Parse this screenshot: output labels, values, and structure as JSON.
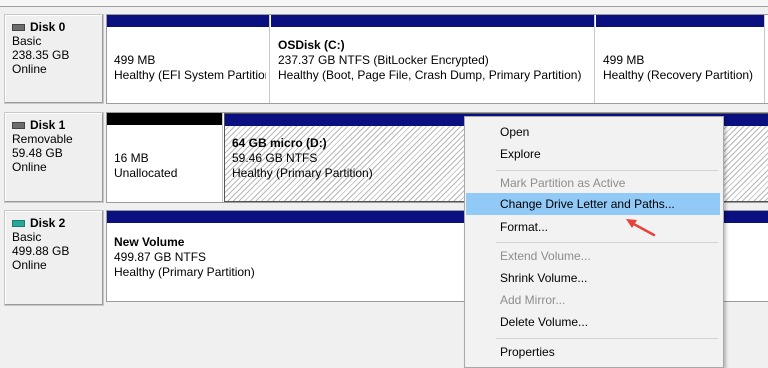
{
  "disks": [
    {
      "name": "Disk 0",
      "type": "Basic",
      "size": "238.35 GB",
      "status": "Online",
      "partitions": [
        {
          "title": "",
          "size": "499 MB",
          "status": "Healthy (EFI System Partition)"
        },
        {
          "title": "OSDisk  (C:)",
          "size": "237.37 GB NTFS (BitLocker Encrypted)",
          "status": "Healthy (Boot, Page File, Crash Dump, Primary Partition)"
        },
        {
          "title": "",
          "size": "499 MB",
          "status": "Healthy (Recovery Partition)"
        }
      ]
    },
    {
      "name": "Disk 1",
      "type": "Removable",
      "size": "59.48 GB",
      "status": "Online",
      "partitions": [
        {
          "title": "",
          "size": "16 MB",
          "status": "Unallocated"
        },
        {
          "title": "64 GB micro  (D:)",
          "size": "59.46 GB NTFS",
          "status": "Healthy (Primary Partition)"
        }
      ]
    },
    {
      "name": "Disk 2",
      "type": "Basic",
      "size": "499.88 GB",
      "status": "Online",
      "partitions": [
        {
          "title": "New Volume",
          "size": "499.87 GB NTFS",
          "status": "Healthy (Primary Partition)"
        }
      ]
    }
  ],
  "context_menu": [
    {
      "label": "Open",
      "enabled": true
    },
    {
      "label": "Explore",
      "enabled": true
    },
    {
      "label": "Mark Partition as Active",
      "enabled": false
    },
    {
      "label": "Change Drive Letter and Paths...",
      "enabled": true,
      "highlighted": true
    },
    {
      "label": "Format...",
      "enabled": true
    },
    {
      "label": "Extend Volume...",
      "enabled": false
    },
    {
      "label": "Shrink Volume...",
      "enabled": true
    },
    {
      "label": "Add Mirror...",
      "enabled": false
    },
    {
      "label": "Delete Volume...",
      "enabled": true
    },
    {
      "label": "Properties",
      "enabled": true
    }
  ],
  "colors": {
    "primary_bar": "#0a1080",
    "unallocated_bar": "#000000",
    "highlight": "#91c9f7",
    "annotation_arrow": "#e8413a"
  },
  "icons": {
    "disk": "disk-drive-icon",
    "removable": "removable-disk-icon",
    "arrow": "red-annotation-arrow"
  }
}
